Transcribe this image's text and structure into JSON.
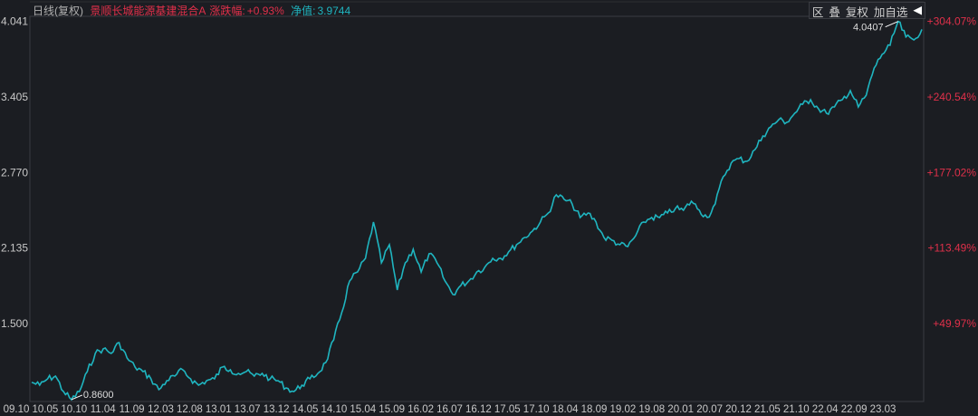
{
  "header": {
    "period": "日线(复权)",
    "fund_name": "景顺长城能源基建混合A",
    "change_label": "涨跌幅:",
    "change_value": "+0.93%",
    "nav_label": "净值:",
    "nav_value": "3.9744"
  },
  "toolbar": {
    "items": [
      "区",
      "叠",
      "复权",
      "加自选",
      "◀"
    ]
  },
  "colors": {
    "line": "#1fb5c0",
    "red": "#e0304a",
    "axis": "#3a3c42",
    "text": "#c8c8c8"
  },
  "chart_data": {
    "type": "line",
    "title": "景顺长城能源基建混合A",
    "ylim": [
      0.86,
      4.041
    ],
    "y_ticks": [
      "4.041",
      "3.405",
      "2.770",
      "2.135",
      "1.500"
    ],
    "y_tick_values": [
      4.041,
      3.405,
      2.77,
      2.135,
      1.5
    ],
    "right_ticks": [
      "+304.07%",
      "+240.54%",
      "+177.02%",
      "+113.49%",
      "+49.97%"
    ],
    "x_ticks": [
      "09.10",
      "10.05",
      "10.10",
      "11.04",
      "11.09",
      "12.03",
      "12.08",
      "13.01",
      "13.07",
      "13.12",
      "14.05",
      "14.10",
      "15.04",
      "15.09",
      "16.02",
      "16.07",
      "16.12",
      "17.05",
      "17.10",
      "18.04",
      "18.09",
      "19.02",
      "19.08",
      "20.01",
      "20.07",
      "20.12",
      "21.05",
      "21.10",
      "22.04",
      "22.09",
      "23.03"
    ],
    "annotations": {
      "min_label": "0.8600",
      "min_value": 0.86,
      "max_label": "4.0407",
      "max_value": 4.0407
    },
    "series": [
      {
        "name": "净值",
        "values": [
          1.005,
          0.982,
          1.035,
          1.058,
          0.928,
          0.86,
          0.928,
          1.096,
          1.249,
          1.287,
          1.249,
          1.34,
          1.21,
          1.134,
          1.096,
          1.035,
          0.944,
          1.02,
          1.058,
          1.111,
          1.035,
          0.982,
          1.02,
          1.035,
          1.134,
          1.111,
          1.081,
          1.096,
          1.058,
          1.081,
          1.035,
          1.02,
          0.959,
          0.928,
          0.982,
          1.035,
          1.081,
          1.172,
          1.363,
          1.591,
          1.858,
          1.934,
          2.049,
          2.354,
          2.011,
          2.163,
          1.782,
          2.011,
          2.125,
          1.934,
          2.087,
          2.011,
          1.858,
          1.744,
          1.82,
          1.858,
          1.934,
          1.973,
          2.049,
          2.049,
          2.102,
          2.163,
          2.224,
          2.277,
          2.354,
          2.43,
          2.582,
          2.544,
          2.506,
          2.392,
          2.43,
          2.354,
          2.224,
          2.201,
          2.163,
          2.148,
          2.239,
          2.354,
          2.392,
          2.392,
          2.43,
          2.468,
          2.453,
          2.529,
          2.453,
          2.392,
          2.506,
          2.735,
          2.849,
          2.887,
          2.864,
          2.963,
          3.078,
          3.154,
          3.215,
          3.192,
          3.268,
          3.344,
          3.383,
          3.306,
          3.268,
          3.322,
          3.383,
          3.459,
          3.322,
          3.421,
          3.649,
          3.764,
          3.84,
          4.0407,
          3.91,
          3.886,
          3.9744
        ]
      }
    ]
  }
}
